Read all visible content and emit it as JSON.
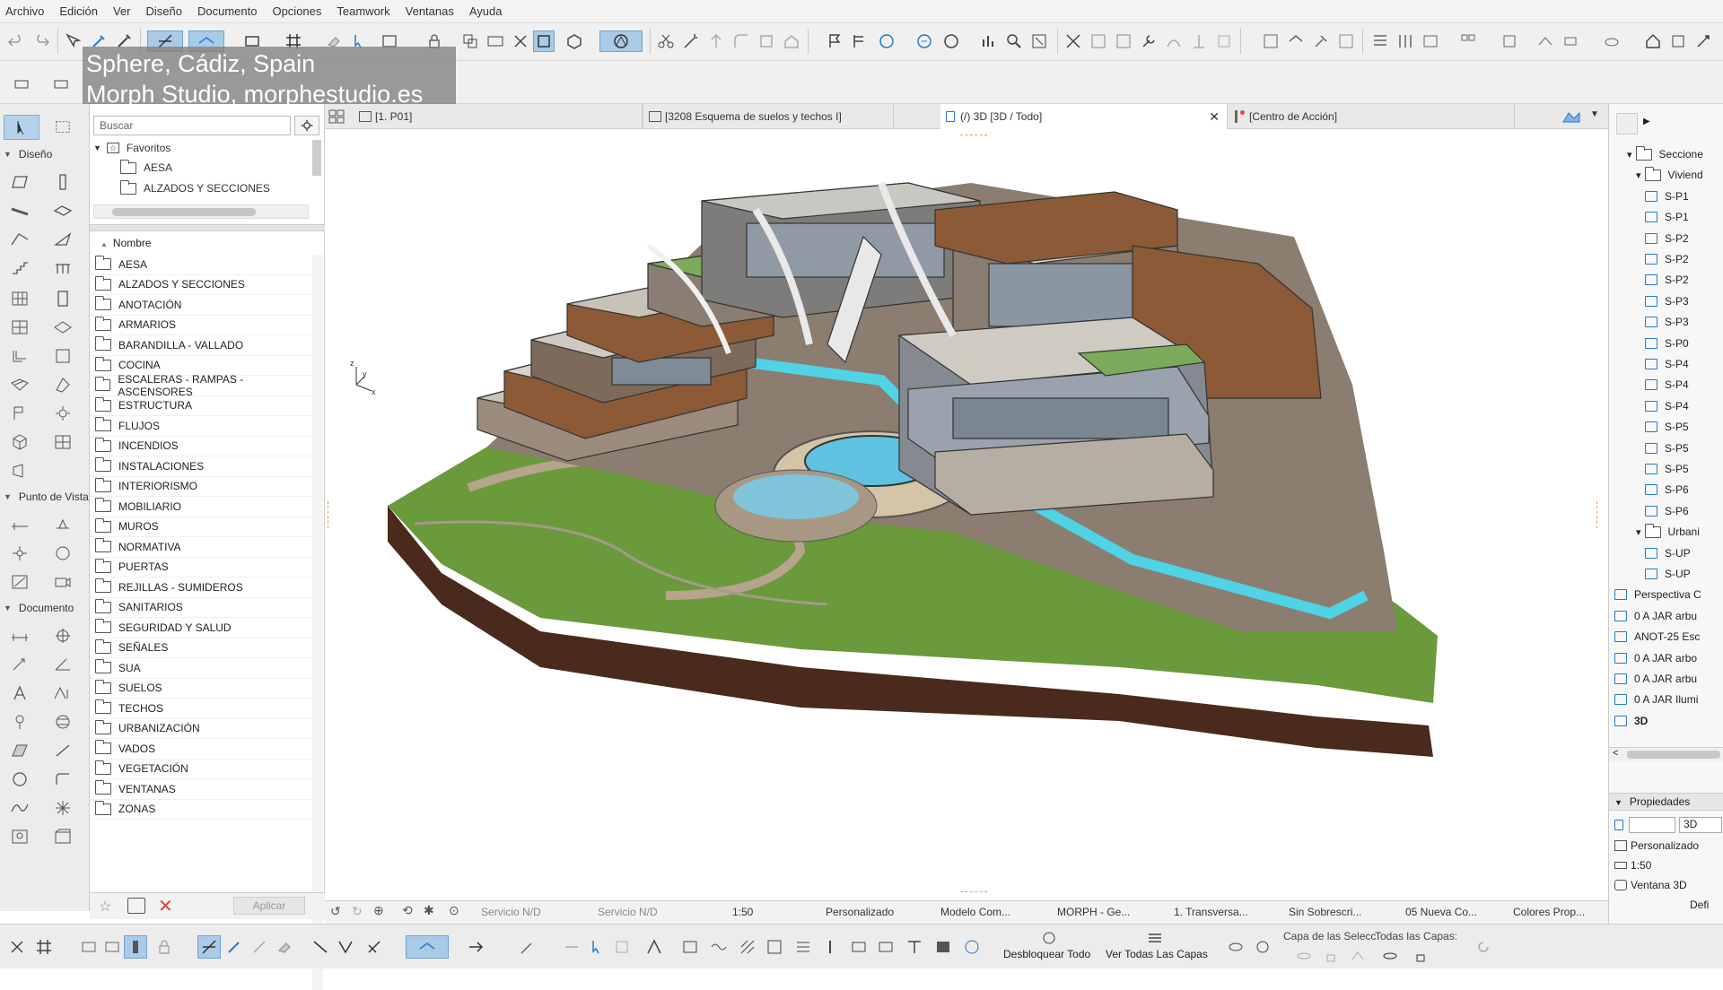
{
  "menu": [
    "Archivo",
    "Edición",
    "Ver",
    "Diseño",
    "Documento",
    "Opciones",
    "Teamwork",
    "Ventanas",
    "Ayuda"
  ],
  "overlay": {
    "line1": "Sphere, Cádiz, Spain",
    "line2": "Morph Studio, morphestudio.es"
  },
  "toolbox": {
    "sections": [
      "Diseño",
      "Punto de Vista",
      "Documento"
    ]
  },
  "navigator": {
    "search_placeholder": "Buscar",
    "favorites_label": "Favoritos",
    "favorites": [
      "AESA",
      "ALZADOS Y SECCIONES"
    ],
    "list_header": "Nombre",
    "items": [
      "AESA",
      "ALZADOS Y SECCIONES",
      "ANOTACIÓN",
      "ARMARIOS",
      "BARANDILLA - VALLADO",
      "COCINA",
      "ESCALERAS - RAMPAS - ASCENSORES",
      "ESTRUCTURA",
      "FLUJOS",
      "INCENDIOS",
      "INSTALACIONES",
      "INTERIORISMO",
      "MOBILIARIO",
      "MUROS",
      "NORMATIVA",
      "PUERTAS",
      "REJILLAS - SUMIDEROS",
      "SANITARIOS",
      "SEGURIDAD Y SALUD",
      "SEÑALES",
      "SUA",
      "SUELOS",
      "TECHOS",
      "URBANIZACIÓN",
      "VADOS",
      "VEGETACIÓN",
      "VENTANAS",
      "ZONAS"
    ],
    "apply_label": "Aplicar"
  },
  "tabs": [
    {
      "label": "[1. P01]"
    },
    {
      "label": "[3208 Esquema de suelos y techos I]"
    },
    {
      "label": "(/) 3D [3D / Todo]"
    },
    {
      "label": "[Centro de Acción]"
    }
  ],
  "right_panel": {
    "items": [
      "Seccione",
      "Viviend",
      "S-P1",
      "S-P1",
      "S-P2",
      "S-P2",
      "S-P2",
      "S-P3",
      "S-P3",
      "S-P0",
      "S-P4",
      "S-P4",
      "S-P4",
      "S-P5",
      "S-P5",
      "S-P5",
      "S-P6",
      "S-P6",
      "Urbani",
      "S-UP",
      "S-UP",
      "Perspectiva C",
      "0 A JAR arbu",
      "ANOT-25 Esc",
      "0 A JAR arbo",
      "0 A JAR arbu",
      "0 A JAR Ilumi",
      "3D"
    ],
    "props_title": "Propiedades",
    "props_value": "3D",
    "props_rows": [
      "Personalizado",
      "1:50",
      "Ventana 3D"
    ],
    "props_button": "Defi"
  },
  "status": [
    "Servicio N/D",
    "Servicio N/D",
    "1:50",
    "Personalizado",
    "Modelo Com...",
    "MORPH - Ge...",
    "1. Transversa...",
    "Sin Sobrescri...",
    "05 Nueva Co...",
    "Colores Prop..."
  ],
  "bottom": {
    "unlock_all": "Desbloquear Todo",
    "show_layers": "Ver Todas Las Capas",
    "layer_selection": "Capa de las Selecc",
    "all_layers": "Todas las Capas:"
  },
  "colors": {
    "accent": "#2a79c8",
    "grass": "#6a9a3c",
    "water": "#5fd5e8",
    "wood": "#8a4a22",
    "soil": "#4a2a1c"
  }
}
